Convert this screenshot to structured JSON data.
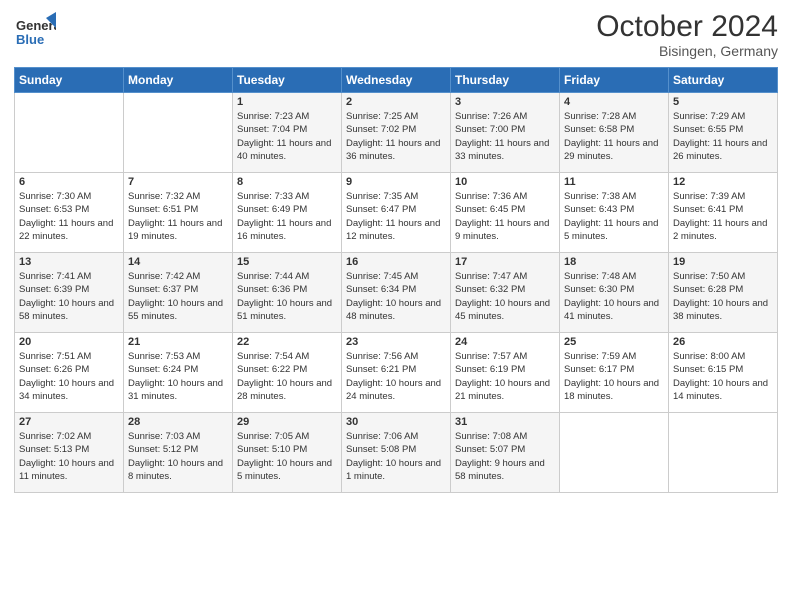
{
  "header": {
    "logo_general": "General",
    "logo_blue": "Blue",
    "month_title": "October 2024",
    "location": "Bisingen, Germany"
  },
  "days_of_week": [
    "Sunday",
    "Monday",
    "Tuesday",
    "Wednesday",
    "Thursday",
    "Friday",
    "Saturday"
  ],
  "weeks": [
    [
      {
        "day": "",
        "sunrise": "",
        "sunset": "",
        "daylight": ""
      },
      {
        "day": "",
        "sunrise": "",
        "sunset": "",
        "daylight": ""
      },
      {
        "day": "1",
        "sunrise": "Sunrise: 7:23 AM",
        "sunset": "Sunset: 7:04 PM",
        "daylight": "Daylight: 11 hours and 40 minutes."
      },
      {
        "day": "2",
        "sunrise": "Sunrise: 7:25 AM",
        "sunset": "Sunset: 7:02 PM",
        "daylight": "Daylight: 11 hours and 36 minutes."
      },
      {
        "day": "3",
        "sunrise": "Sunrise: 7:26 AM",
        "sunset": "Sunset: 7:00 PM",
        "daylight": "Daylight: 11 hours and 33 minutes."
      },
      {
        "day": "4",
        "sunrise": "Sunrise: 7:28 AM",
        "sunset": "Sunset: 6:58 PM",
        "daylight": "Daylight: 11 hours and 29 minutes."
      },
      {
        "day": "5",
        "sunrise": "Sunrise: 7:29 AM",
        "sunset": "Sunset: 6:55 PM",
        "daylight": "Daylight: 11 hours and 26 minutes."
      }
    ],
    [
      {
        "day": "6",
        "sunrise": "Sunrise: 7:30 AM",
        "sunset": "Sunset: 6:53 PM",
        "daylight": "Daylight: 11 hours and 22 minutes."
      },
      {
        "day": "7",
        "sunrise": "Sunrise: 7:32 AM",
        "sunset": "Sunset: 6:51 PM",
        "daylight": "Daylight: 11 hours and 19 minutes."
      },
      {
        "day": "8",
        "sunrise": "Sunrise: 7:33 AM",
        "sunset": "Sunset: 6:49 PM",
        "daylight": "Daylight: 11 hours and 16 minutes."
      },
      {
        "day": "9",
        "sunrise": "Sunrise: 7:35 AM",
        "sunset": "Sunset: 6:47 PM",
        "daylight": "Daylight: 11 hours and 12 minutes."
      },
      {
        "day": "10",
        "sunrise": "Sunrise: 7:36 AM",
        "sunset": "Sunset: 6:45 PM",
        "daylight": "Daylight: 11 hours and 9 minutes."
      },
      {
        "day": "11",
        "sunrise": "Sunrise: 7:38 AM",
        "sunset": "Sunset: 6:43 PM",
        "daylight": "Daylight: 11 hours and 5 minutes."
      },
      {
        "day": "12",
        "sunrise": "Sunrise: 7:39 AM",
        "sunset": "Sunset: 6:41 PM",
        "daylight": "Daylight: 11 hours and 2 minutes."
      }
    ],
    [
      {
        "day": "13",
        "sunrise": "Sunrise: 7:41 AM",
        "sunset": "Sunset: 6:39 PM",
        "daylight": "Daylight: 10 hours and 58 minutes."
      },
      {
        "day": "14",
        "sunrise": "Sunrise: 7:42 AM",
        "sunset": "Sunset: 6:37 PM",
        "daylight": "Daylight: 10 hours and 55 minutes."
      },
      {
        "day": "15",
        "sunrise": "Sunrise: 7:44 AM",
        "sunset": "Sunset: 6:36 PM",
        "daylight": "Daylight: 10 hours and 51 minutes."
      },
      {
        "day": "16",
        "sunrise": "Sunrise: 7:45 AM",
        "sunset": "Sunset: 6:34 PM",
        "daylight": "Daylight: 10 hours and 48 minutes."
      },
      {
        "day": "17",
        "sunrise": "Sunrise: 7:47 AM",
        "sunset": "Sunset: 6:32 PM",
        "daylight": "Daylight: 10 hours and 45 minutes."
      },
      {
        "day": "18",
        "sunrise": "Sunrise: 7:48 AM",
        "sunset": "Sunset: 6:30 PM",
        "daylight": "Daylight: 10 hours and 41 minutes."
      },
      {
        "day": "19",
        "sunrise": "Sunrise: 7:50 AM",
        "sunset": "Sunset: 6:28 PM",
        "daylight": "Daylight: 10 hours and 38 minutes."
      }
    ],
    [
      {
        "day": "20",
        "sunrise": "Sunrise: 7:51 AM",
        "sunset": "Sunset: 6:26 PM",
        "daylight": "Daylight: 10 hours and 34 minutes."
      },
      {
        "day": "21",
        "sunrise": "Sunrise: 7:53 AM",
        "sunset": "Sunset: 6:24 PM",
        "daylight": "Daylight: 10 hours and 31 minutes."
      },
      {
        "day": "22",
        "sunrise": "Sunrise: 7:54 AM",
        "sunset": "Sunset: 6:22 PM",
        "daylight": "Daylight: 10 hours and 28 minutes."
      },
      {
        "day": "23",
        "sunrise": "Sunrise: 7:56 AM",
        "sunset": "Sunset: 6:21 PM",
        "daylight": "Daylight: 10 hours and 24 minutes."
      },
      {
        "day": "24",
        "sunrise": "Sunrise: 7:57 AM",
        "sunset": "Sunset: 6:19 PM",
        "daylight": "Daylight: 10 hours and 21 minutes."
      },
      {
        "day": "25",
        "sunrise": "Sunrise: 7:59 AM",
        "sunset": "Sunset: 6:17 PM",
        "daylight": "Daylight: 10 hours and 18 minutes."
      },
      {
        "day": "26",
        "sunrise": "Sunrise: 8:00 AM",
        "sunset": "Sunset: 6:15 PM",
        "daylight": "Daylight: 10 hours and 14 minutes."
      }
    ],
    [
      {
        "day": "27",
        "sunrise": "Sunrise: 7:02 AM",
        "sunset": "Sunset: 5:13 PM",
        "daylight": "Daylight: 10 hours and 11 minutes."
      },
      {
        "day": "28",
        "sunrise": "Sunrise: 7:03 AM",
        "sunset": "Sunset: 5:12 PM",
        "daylight": "Daylight: 10 hours and 8 minutes."
      },
      {
        "day": "29",
        "sunrise": "Sunrise: 7:05 AM",
        "sunset": "Sunset: 5:10 PM",
        "daylight": "Daylight: 10 hours and 5 minutes."
      },
      {
        "day": "30",
        "sunrise": "Sunrise: 7:06 AM",
        "sunset": "Sunset: 5:08 PM",
        "daylight": "Daylight: 10 hours and 1 minute."
      },
      {
        "day": "31",
        "sunrise": "Sunrise: 7:08 AM",
        "sunset": "Sunset: 5:07 PM",
        "daylight": "Daylight: 9 hours and 58 minutes."
      },
      {
        "day": "",
        "sunrise": "",
        "sunset": "",
        "daylight": ""
      },
      {
        "day": "",
        "sunrise": "",
        "sunset": "",
        "daylight": ""
      }
    ]
  ]
}
